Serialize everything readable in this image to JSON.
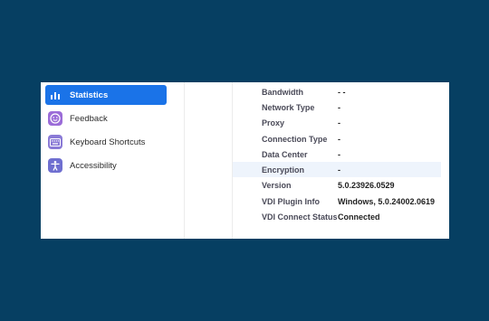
{
  "sidebar": {
    "items": [
      {
        "label": "Statistics",
        "icon": "bar-chart-icon",
        "color": "#1a73e8",
        "active": true
      },
      {
        "label": "Feedback",
        "icon": "smiley-icon",
        "color": "#9b6cd8"
      },
      {
        "label": "Keyboard Shortcuts",
        "icon": "keyboard-icon",
        "color": "#8a7ad6"
      },
      {
        "label": "Accessibility",
        "icon": "accessibility-icon",
        "color": "#6f6fd0"
      }
    ]
  },
  "details": {
    "rows": [
      {
        "label": "Bandwidth",
        "value": "-  -"
      },
      {
        "label": "Network Type",
        "value": "-"
      },
      {
        "label": "Proxy",
        "value": "-"
      },
      {
        "label": "Connection Type",
        "value": "-"
      },
      {
        "label": "Data Center",
        "value": "-"
      },
      {
        "label": "Encryption",
        "value": "-"
      },
      {
        "label": "Version",
        "value": "5.0.23926.0529"
      },
      {
        "label": "VDI Plugin Info",
        "value": "Windows, 5.0.24002.0619"
      },
      {
        "label": "VDI Connect Status",
        "value": "Connected"
      }
    ]
  },
  "colors": {
    "background": "#063f62",
    "accent": "#1a73e8",
    "highlight_row": "#eef4fc"
  }
}
